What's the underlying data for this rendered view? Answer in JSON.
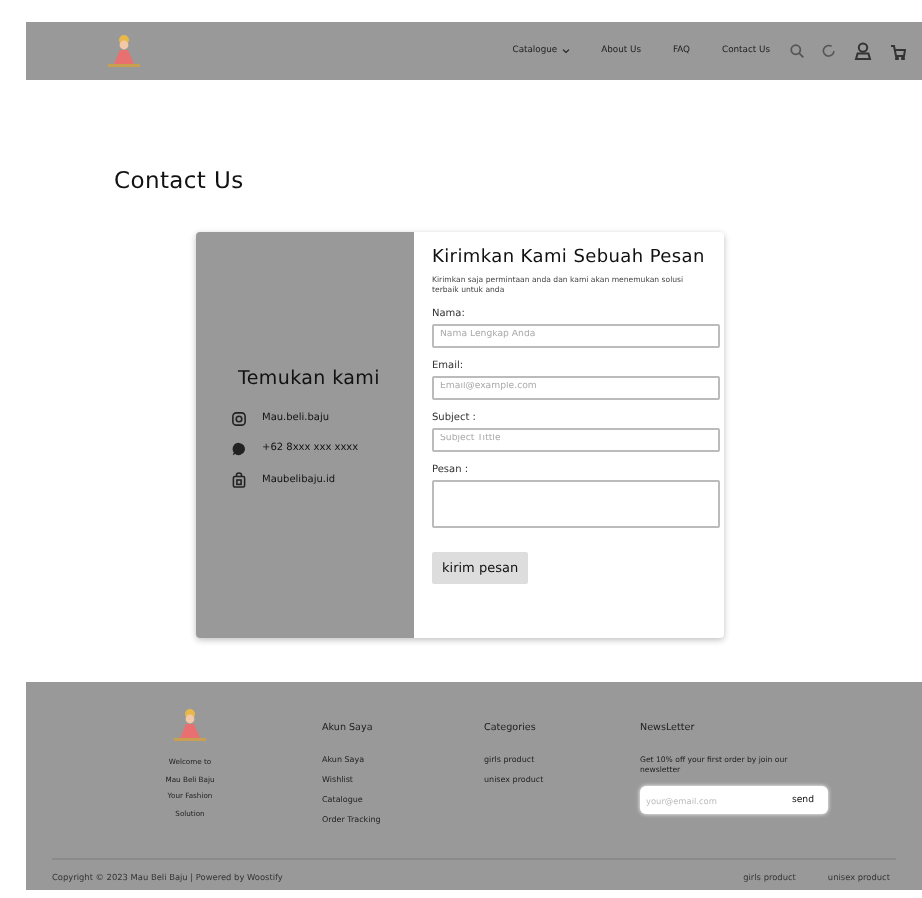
{
  "header": {
    "nav": [
      {
        "label": "Catalogue",
        "dropdown": true
      },
      {
        "label": "About Us",
        "dropdown": false
      },
      {
        "label": "FAQ",
        "dropdown": false
      },
      {
        "label": "Contact Us",
        "dropdown": false
      }
    ]
  },
  "page_title": "Contact Us",
  "contact_card": {
    "left": {
      "title": "Temukan kami",
      "items": [
        {
          "kind": "instagram",
          "text": "Mau.beli.baju"
        },
        {
          "kind": "whatsapp",
          "text": "+62 8xxx xxx xxxx"
        },
        {
          "kind": "shop",
          "text": "Maubelibaju.id"
        }
      ]
    },
    "form": {
      "title": "Kirimkan Kami Sebuah Pesan",
      "subtitle": "Kirimkan saja permintaan anda dan kami akan menemukan  solusi terbaik untuk anda",
      "fields": [
        {
          "kind": "input",
          "label": "Nama:",
          "placeholder": "Nama Lengkap Anda"
        },
        {
          "kind": "input",
          "label": "Email:",
          "placeholder": "Email@example.com"
        },
        {
          "kind": "input",
          "label": "Subject :",
          "placeholder": "Subject Tittle"
        },
        {
          "kind": "textarea",
          "label": "Pesan :"
        }
      ],
      "button": "kirim pesan"
    }
  },
  "footer": {
    "tagline": [
      "Welcome to",
      "Mau Beli Baju",
      "Your Fashion",
      "Solution"
    ],
    "columns": [
      {
        "heading": "Akun Saya",
        "links": [
          "Akun Saya",
          "Wishlist",
          "Catalogue",
          "Order Tracking"
        ]
      },
      {
        "heading": "Categories",
        "links": [
          "girls product",
          "unisex product"
        ]
      }
    ],
    "newsletter": {
      "heading": "NewsLetter",
      "text": "Get 10% off your first order by join our newsletter",
      "placeholder": "your@email.com",
      "button": "send"
    },
    "copyright": "Copyright © 2023 Mau Beli Baju | Powered by Woostify",
    "bottom_links": [
      "girls product",
      "unisex product"
    ]
  }
}
